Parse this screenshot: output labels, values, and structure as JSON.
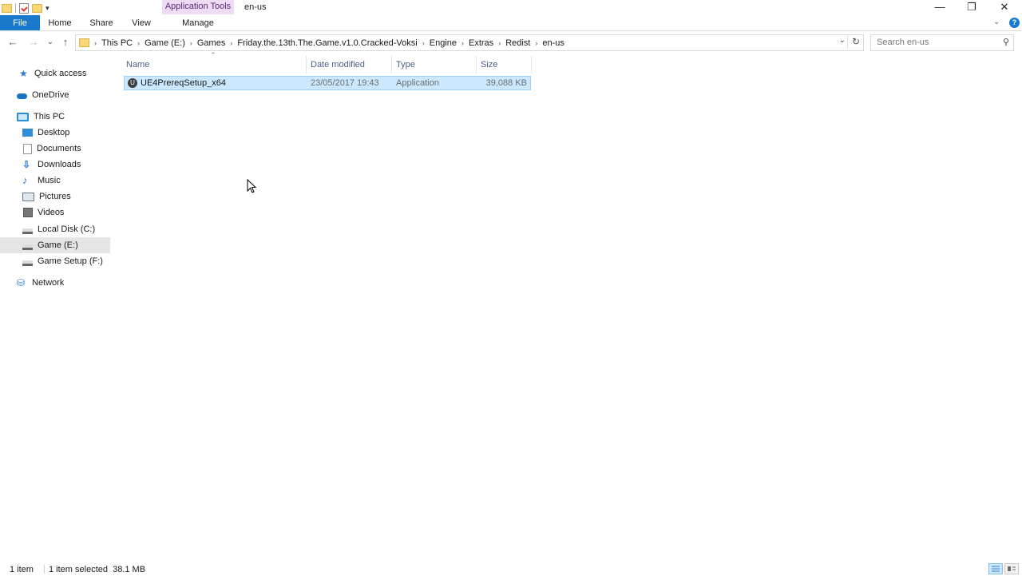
{
  "window": {
    "context_group": "Application Tools",
    "title": "en-us",
    "minimize_glyph": "—",
    "restore_glyph": "❐",
    "close_glyph": "✕"
  },
  "ribbon": {
    "tabs": {
      "file": "File",
      "home": "Home",
      "share": "Share",
      "view": "View",
      "manage": "Manage"
    },
    "collapse_glyph": "⌄",
    "help_glyph": "?"
  },
  "navigation": {
    "back_glyph": "←",
    "forward_glyph": "→",
    "recent_glyph": "⌄",
    "up_glyph": "↑"
  },
  "address": {
    "crumbs": [
      "This PC",
      "Game (E:)",
      "Games",
      "Friday.the.13th.The.Game.v1.0.Cracked-Voksi",
      "Engine",
      "Extras",
      "Redist",
      "en-us"
    ],
    "separator_glyph": "›",
    "dropdown_glyph": "⌄",
    "refresh_glyph": "↻"
  },
  "search": {
    "placeholder": "Search en-us",
    "icon_glyph": "⚲"
  },
  "nav_pane": {
    "items": [
      {
        "label": "Quick access",
        "icon": "star-icon"
      },
      {
        "label": "OneDrive",
        "icon": "cloud-icon"
      },
      {
        "label": "This PC",
        "icon": "computer-icon"
      },
      {
        "label": "Desktop",
        "icon": "desktop-icon"
      },
      {
        "label": "Documents",
        "icon": "documents-icon"
      },
      {
        "label": "Downloads",
        "icon": "downloads-icon"
      },
      {
        "label": "Music",
        "icon": "music-icon"
      },
      {
        "label": "Pictures",
        "icon": "pictures-icon"
      },
      {
        "label": "Videos",
        "icon": "videos-icon"
      },
      {
        "label": "Local Disk (C:)",
        "icon": "drive-icon"
      },
      {
        "label": "Game (E:)",
        "icon": "drive-icon",
        "selected": true
      },
      {
        "label": "Game Setup (F:)",
        "icon": "drive-icon"
      },
      {
        "label": "Network",
        "icon": "network-icon"
      }
    ],
    "glyphs": {
      "star": "★",
      "down": "⇩",
      "music": "♪",
      "net": "⛁"
    }
  },
  "file_list": {
    "sort_glyph": "⌃",
    "columns": {
      "name": "Name",
      "date": "Date modified",
      "type": "Type",
      "size": "Size"
    },
    "rows": [
      {
        "name": "UE4PrereqSetup_x64",
        "date": "23/05/2017 19:43",
        "type": "Application",
        "size": "39,088 KB",
        "icon": "unreal-app-icon",
        "selected": true
      }
    ],
    "app_icon_glyph": "U"
  },
  "status": {
    "item_count": "1 item",
    "selection": "1 item selected  38.1 MB"
  },
  "colors": {
    "accent": "#1979ca",
    "selection_bg": "#cce8ff",
    "selection_border": "#99d1ff",
    "context_tab_bg": "#eddcf4"
  }
}
